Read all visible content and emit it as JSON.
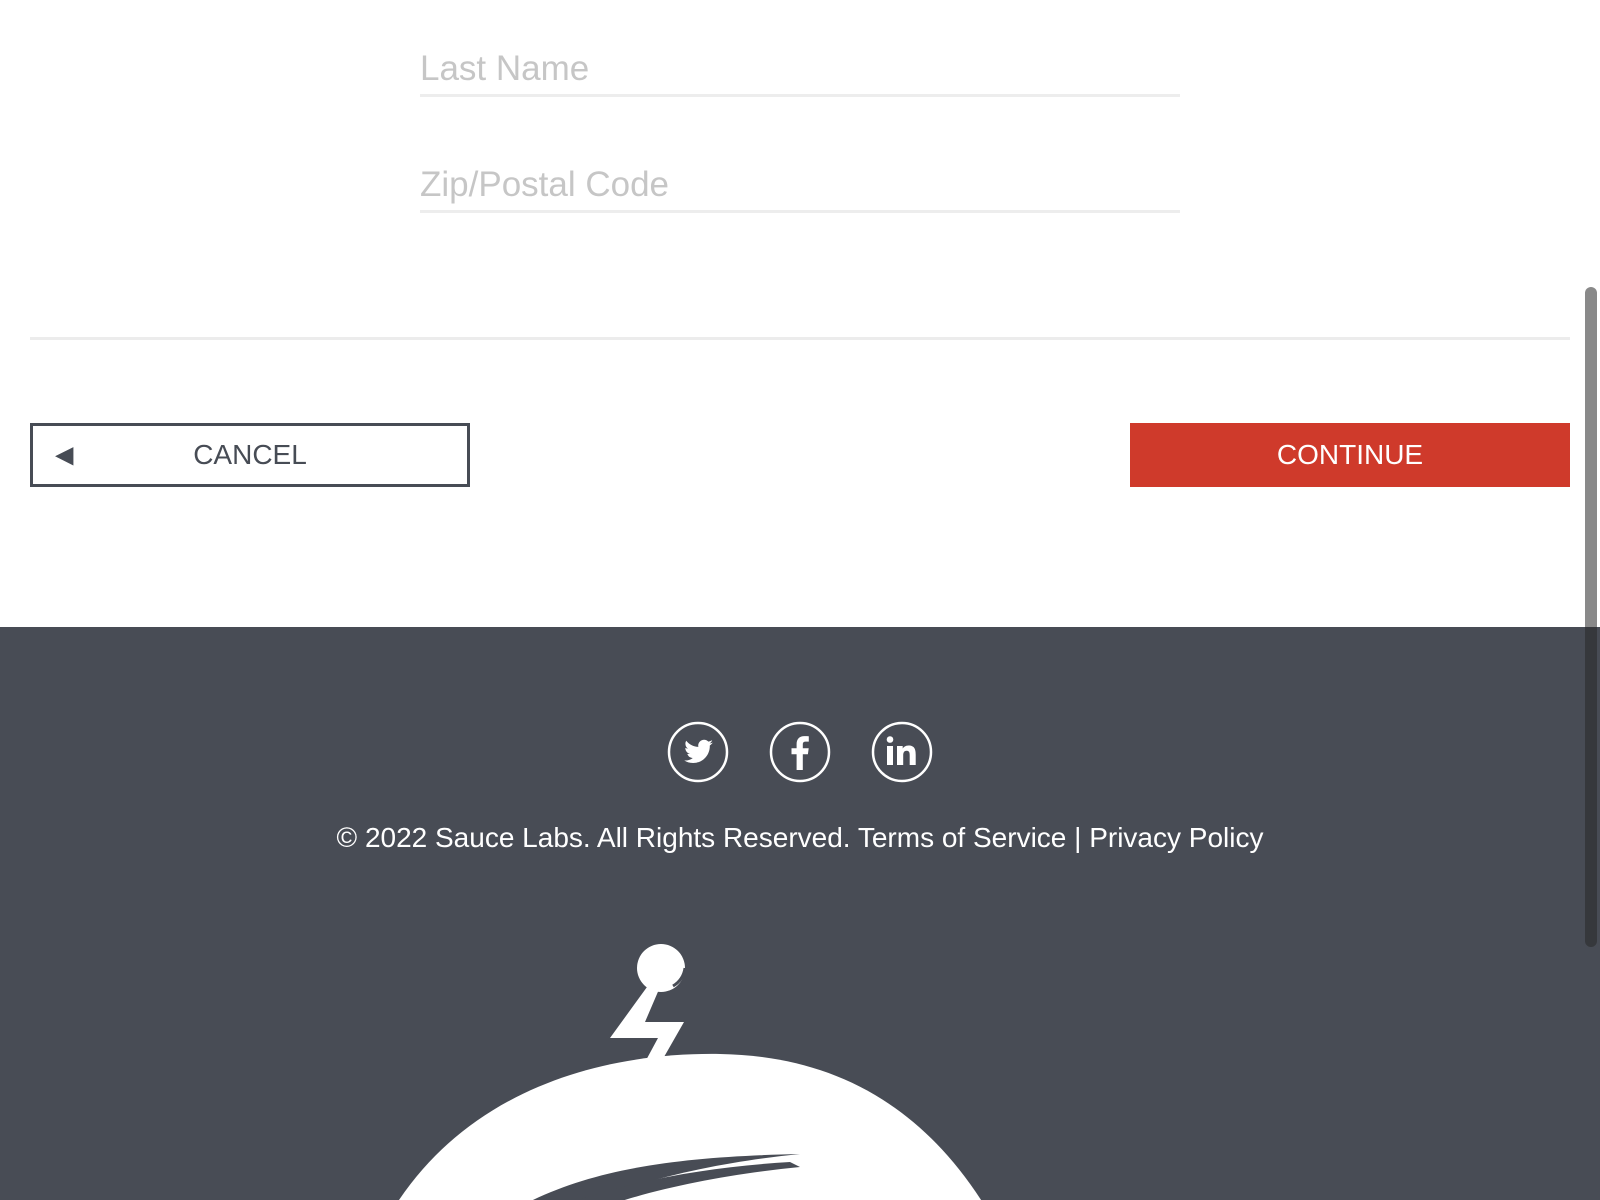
{
  "form": {
    "last_name_placeholder": "Last Name",
    "zip_placeholder": "Zip/Postal Code"
  },
  "actions": {
    "cancel_arrow": "◀",
    "cancel_label": "CANCEL",
    "continue_label": "CONTINUE"
  },
  "footer": {
    "social": [
      "twitter-icon",
      "facebook-icon",
      "linkedin-icon"
    ],
    "copyright_text": "© 2022 Sauce Labs. All Rights Reserved.",
    "terms_label": "Terms of Service",
    "separator": "|",
    "privacy_label": "Privacy Policy"
  },
  "colors": {
    "accent_red": "#cf3a2b",
    "footer_bg": "#484c55",
    "outline_dark": "#474c55"
  }
}
